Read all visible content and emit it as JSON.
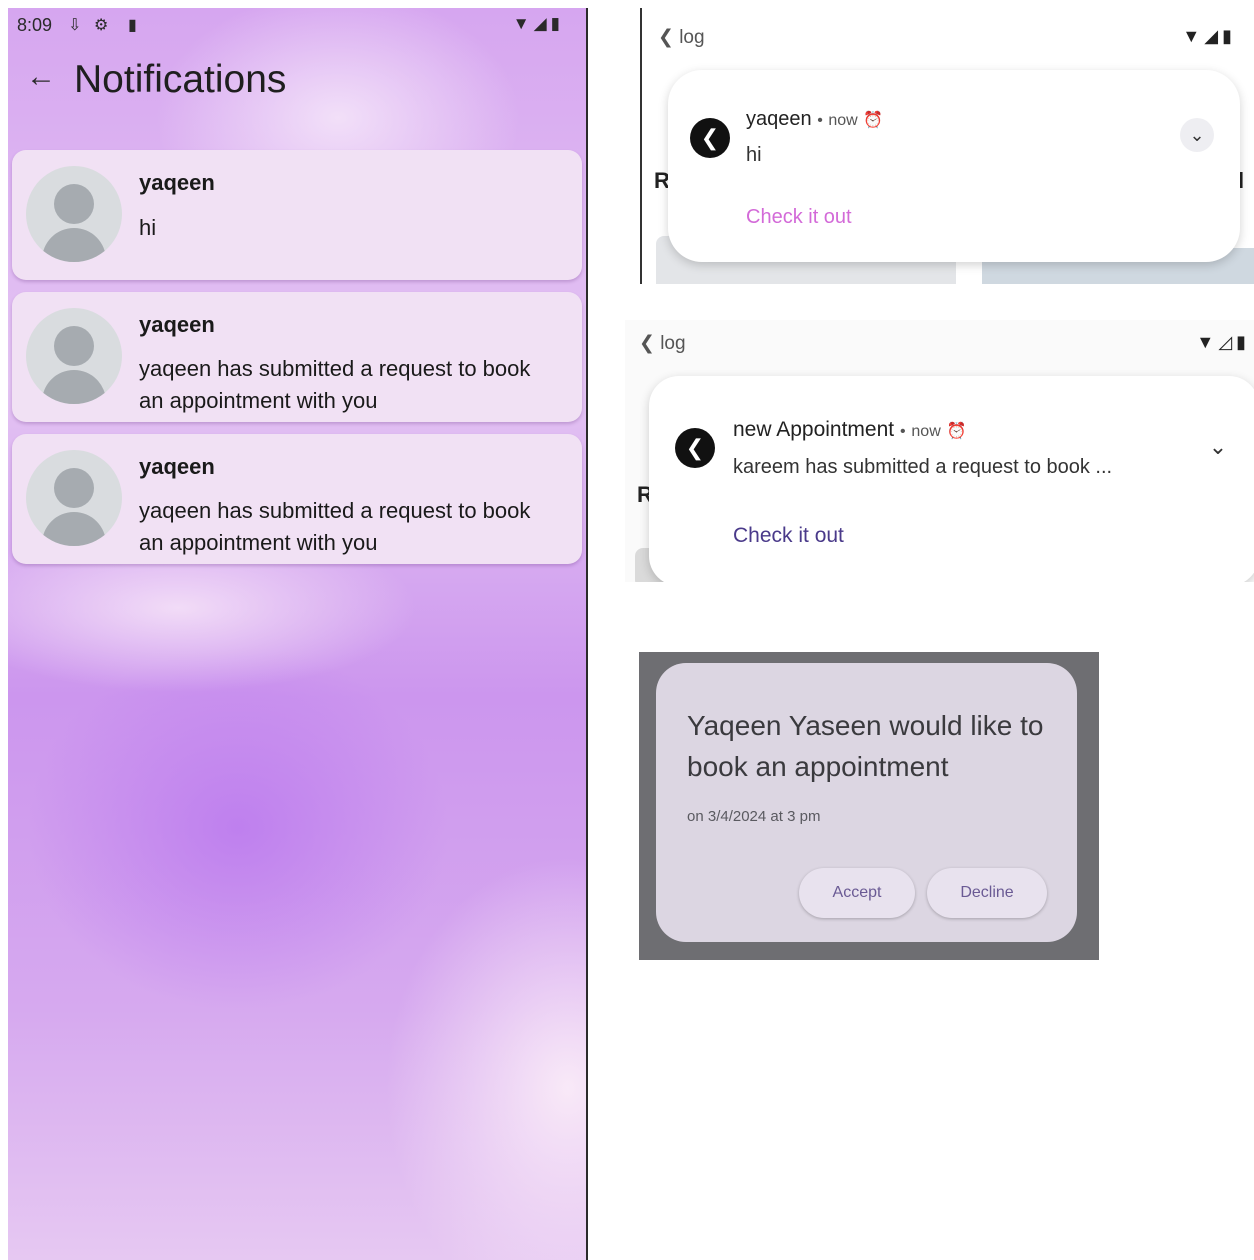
{
  "phone": {
    "status_time": "8:09",
    "status_icons_left": [
      "download-icon",
      "gear-icon",
      "sd-card-icon"
    ],
    "status_icons_right": [
      "wifi-icon",
      "signal-icon",
      "battery-icon"
    ],
    "title": "Notifications",
    "back_icon": "arrow-left-icon",
    "notifications": [
      {
        "name": "yaqeen",
        "message": "hi"
      },
      {
        "name": "yaqeen",
        "message": "yaqeen has submitted a request to book an appointment with you"
      },
      {
        "name": "yaqeen",
        "message": "yaqeen has submitted a request to book an appointment with you"
      }
    ]
  },
  "heads_up": [
    {
      "status_app": "log",
      "edge_left": "R",
      "edge_right": "l",
      "title": "yaqeen",
      "time": "now",
      "body": "hi",
      "action": "Check it out",
      "action_color": "#d36ad8"
    },
    {
      "status_app": "log",
      "edge_left": "R",
      "title": "new Appointment",
      "time": "now",
      "body": "kareem has submitted a request to book ...",
      "action": "Check it out",
      "action_color": "#4a3a8a"
    }
  ],
  "dialog": {
    "title": "Yaqeen Yaseen would like to book an appointment",
    "subtitle": "on 3/4/2024 at 3 pm",
    "accept_label": "Accept",
    "decline_label": "Decline"
  },
  "colors": {
    "phone_background": "#d6a6f0",
    "card_background": "#f1e1f4",
    "dialog_background": "#dcd6e2",
    "dialog_overlay": "#6e6e72"
  }
}
